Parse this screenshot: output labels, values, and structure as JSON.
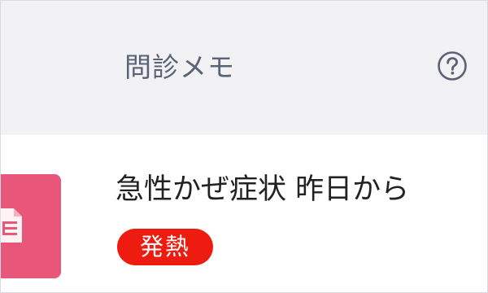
{
  "header": {
    "title": "問診メモ",
    "help_icon": "question-circle-icon"
  },
  "entry": {
    "thumbnail_icon": "document-icon",
    "symptom_text": "急性かぜ症状 昨日から",
    "tag_label": "発熱"
  },
  "colors": {
    "header_bg": "#f2f2f5",
    "header_text": "#5a6275",
    "thumbnail_bg": "#e8577a",
    "tag_bg": "#ee1b10",
    "tag_text": "#ffffff",
    "body_text": "#222222"
  }
}
